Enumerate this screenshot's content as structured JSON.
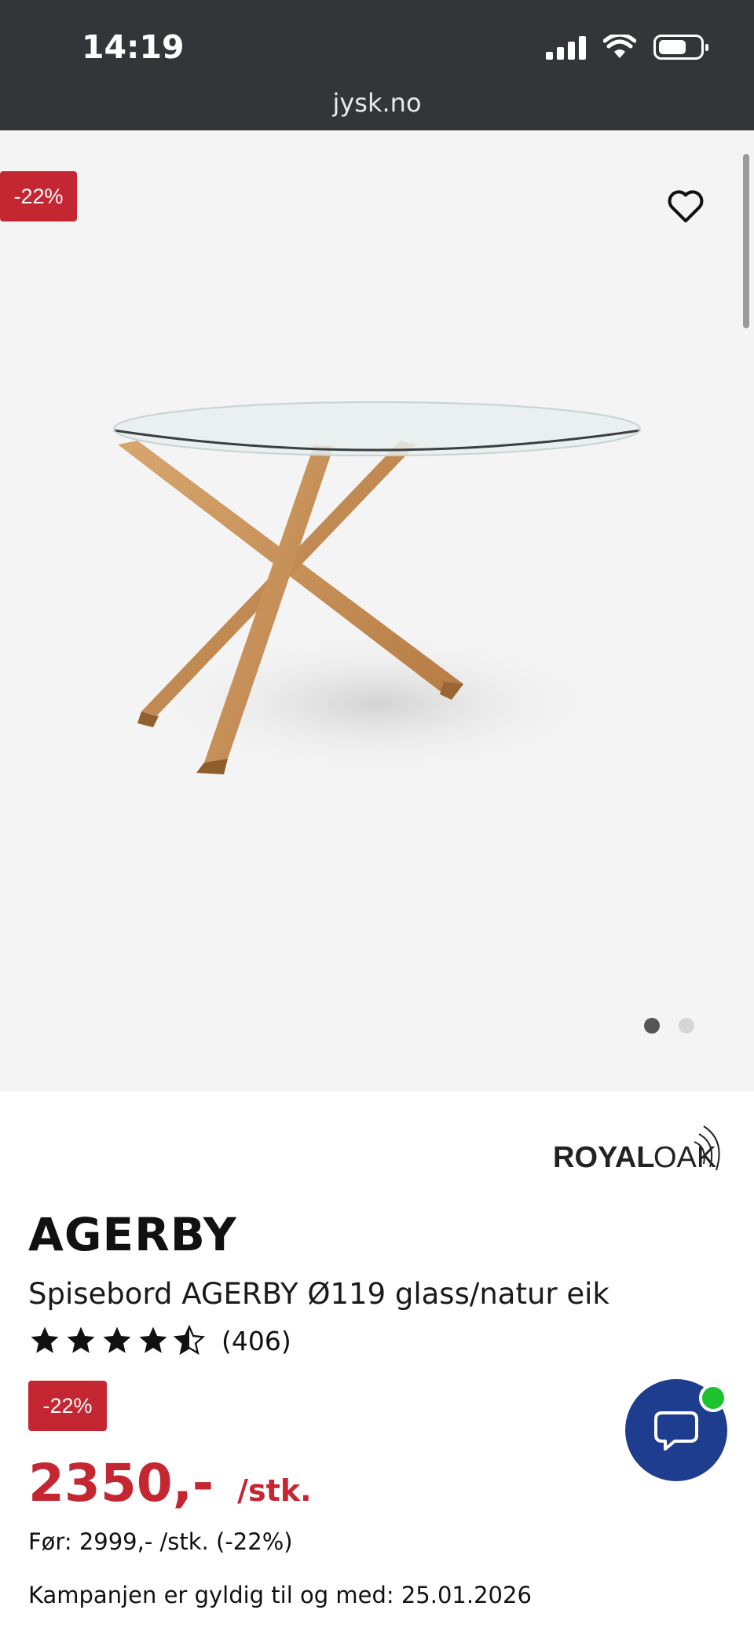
{
  "status_bar": {
    "time": "14:19"
  },
  "browser": {
    "url": "jysk.no"
  },
  "gallery": {
    "discount_badge": "-22%",
    "image_count": 2,
    "active_image": 1
  },
  "product": {
    "brand": "ROYALOAK",
    "brand_suffix": "OAK",
    "brand_prefix": "ROYAL",
    "name": "AGERBY",
    "description": "Spisebord AGERBY Ø119 glass/natur eik",
    "rating": 4.5,
    "review_count": "(406)",
    "discount_badge": "-22%",
    "price": "2350,-",
    "unit": "/stk.",
    "before_price": "Før: 2999,- /stk. (-22%)",
    "campaign": "Kampanjen er gyldig til og med: 25.01.2026"
  },
  "colors": {
    "topbar": "#333538",
    "accent_red": "#c42732",
    "chat_blue": "#1f3d8f",
    "online_green": "#1ec12e"
  }
}
